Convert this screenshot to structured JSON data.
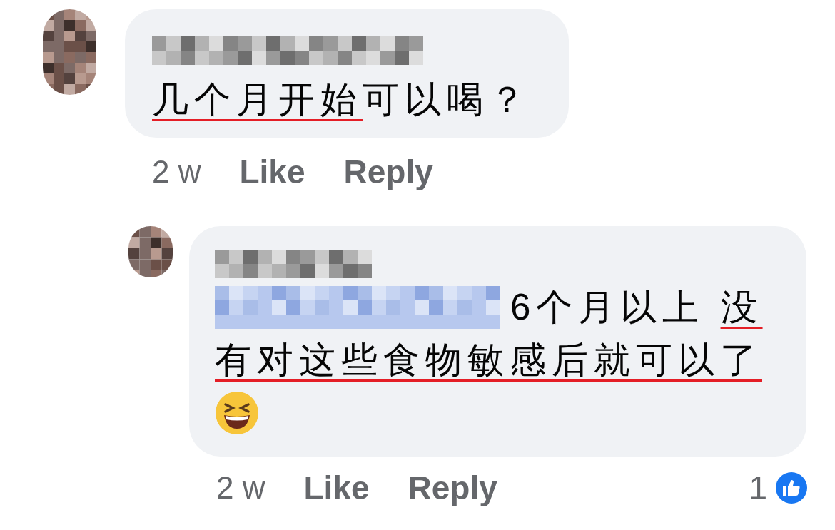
{
  "comments": [
    {
      "lines": [
        [
          {
            "text": "几个月开始",
            "underlined": true
          },
          {
            "text": "可以喝？",
            "underlined": false
          }
        ]
      ],
      "time": "2 w",
      "like": "Like",
      "reply": "Reply"
    },
    {
      "lines": [
        [
          {
            "kind": "mention"
          },
          {
            "text": "6个月以上 ",
            "underlined": false
          },
          {
            "text": "没",
            "underlined": true
          }
        ],
        [
          {
            "text": "有对这些食物敏感后就可以了",
            "underlined": true
          }
        ],
        [
          {
            "kind": "emoji"
          }
        ]
      ],
      "time": "2 w",
      "like": "Like",
      "reply": "Reply",
      "reaction_count": "1"
    }
  ]
}
